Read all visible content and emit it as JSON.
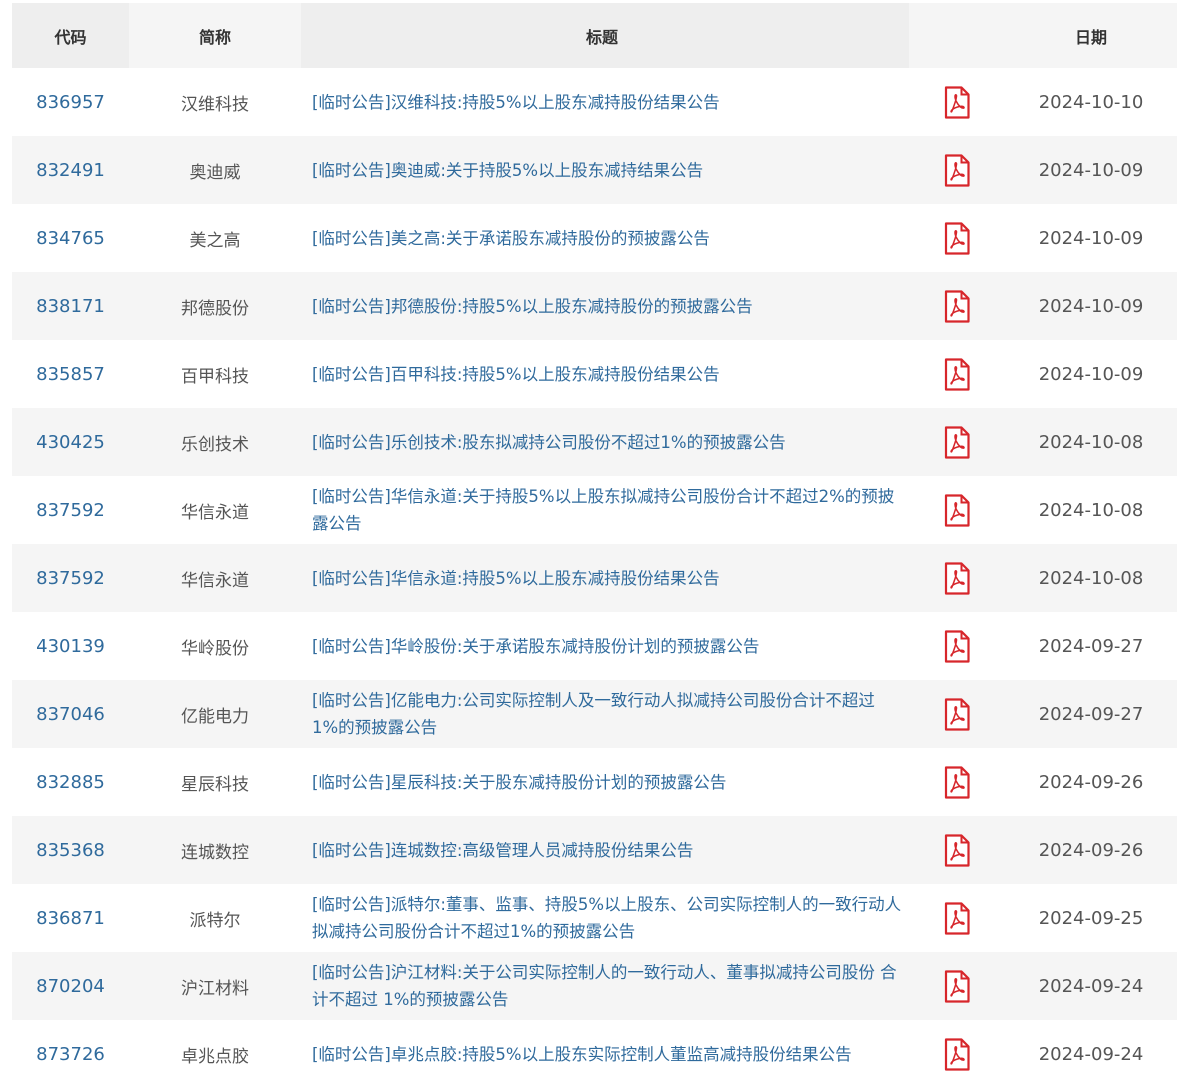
{
  "header": {
    "code": "代码",
    "name": "简称",
    "title": "标题",
    "date": "日期"
  },
  "pdf_icon": "pdf-file-icon",
  "colors": {
    "link": "#2f6a9c",
    "pdf": "#d7262b",
    "stripe": "#f5f5f5"
  },
  "rows": [
    {
      "code": "836957",
      "name": "汉维科技",
      "title": "[临时公告]汉维科技:持股5%以上股东减持股份结果公告",
      "date": "2024-10-10"
    },
    {
      "code": "832491",
      "name": "奥迪威",
      "title": "[临时公告]奥迪威:关于持股5%以上股东减持结果公告",
      "date": "2024-10-09"
    },
    {
      "code": "834765",
      "name": "美之高",
      "title": "[临时公告]美之高:关于承诺股东减持股份的预披露公告",
      "date": "2024-10-09"
    },
    {
      "code": "838171",
      "name": "邦德股份",
      "title": "[临时公告]邦德股份:持股5%以上股东减持股份的预披露公告",
      "date": "2024-10-09"
    },
    {
      "code": "835857",
      "name": "百甲科技",
      "title": "[临时公告]百甲科技:持股5%以上股东减持股份结果公告",
      "date": "2024-10-09"
    },
    {
      "code": "430425",
      "name": "乐创技术",
      "title": "[临时公告]乐创技术:股东拟减持公司股份不超过1%的预披露公告",
      "date": "2024-10-08"
    },
    {
      "code": "837592",
      "name": "华信永道",
      "title": "[临时公告]华信永道:关于持股5%以上股东拟减持公司股份合计不超过2%的预披露公告",
      "date": "2024-10-08"
    },
    {
      "code": "837592",
      "name": "华信永道",
      "title": "[临时公告]华信永道:持股5%以上股东减持股份结果公告",
      "date": "2024-10-08"
    },
    {
      "code": "430139",
      "name": "华岭股份",
      "title": "[临时公告]华岭股份:关于承诺股东减持股份计划的预披露公告",
      "date": "2024-09-27"
    },
    {
      "code": "837046",
      "name": "亿能电力",
      "title": "[临时公告]亿能电力:公司实际控制人及一致行动人拟减持公司股份合计不超过 1%的预披露公告",
      "date": "2024-09-27"
    },
    {
      "code": "832885",
      "name": "星辰科技",
      "title": "[临时公告]星辰科技:关于股东减持股份计划的预披露公告",
      "date": "2024-09-26"
    },
    {
      "code": "835368",
      "name": "连城数控",
      "title": "[临时公告]连城数控:高级管理人员减持股份结果公告",
      "date": "2024-09-26"
    },
    {
      "code": "836871",
      "name": "派特尔",
      "title": "[临时公告]派特尔:董事、监事、持股5%以上股东、公司实际控制人的一致行动人拟减持公司股份合计不超过1%的预披露公告",
      "date": "2024-09-25"
    },
    {
      "code": "870204",
      "name": "沪江材料",
      "title": "[临时公告]沪江材料:关于公司实际控制人的一致行动人、董事拟减持公司股份 合计不超过 1%的预披露公告",
      "date": "2024-09-24"
    },
    {
      "code": "873726",
      "name": "卓兆点胶",
      "title": "[临时公告]卓兆点胶:持股5%以上股东实际控制人董监高减持股份结果公告",
      "date": "2024-09-24"
    }
  ]
}
